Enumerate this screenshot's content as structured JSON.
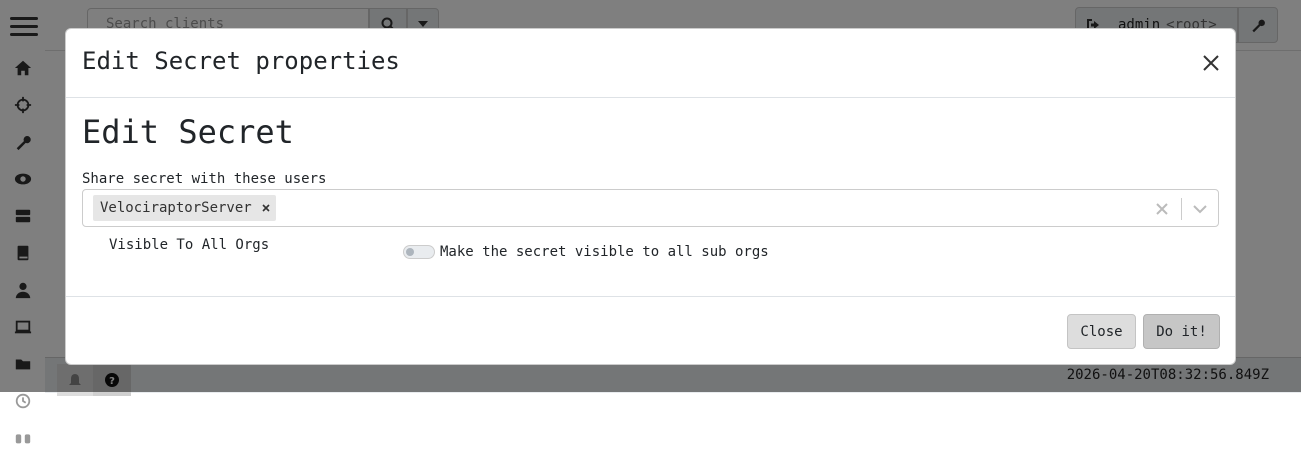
{
  "search": {
    "placeholder": "Search clients"
  },
  "user": {
    "name": "admin",
    "role": "<root>"
  },
  "status": {
    "timestamp": "2026-04-20T08:32:56.849Z"
  },
  "sidebar": {
    "icons": [
      "home-icon",
      "crosshair-icon",
      "wrench-icon",
      "eye-icon",
      "server-icon",
      "book-icon",
      "user-icon",
      "laptop-icon",
      "folder-icon",
      "history-icon",
      "binoculars-icon"
    ]
  },
  "modal": {
    "title": "Edit Secret properties",
    "section_title": "Edit Secret",
    "share_label": "Share secret with these users",
    "selected_users": [
      "VelociraptorServer"
    ],
    "visible_label": "Visible To All Orgs",
    "toggle_label": "Make the secret visible to all sub orgs",
    "toggle_on": false,
    "close_button": "Close",
    "submit_button": "Do it!"
  }
}
